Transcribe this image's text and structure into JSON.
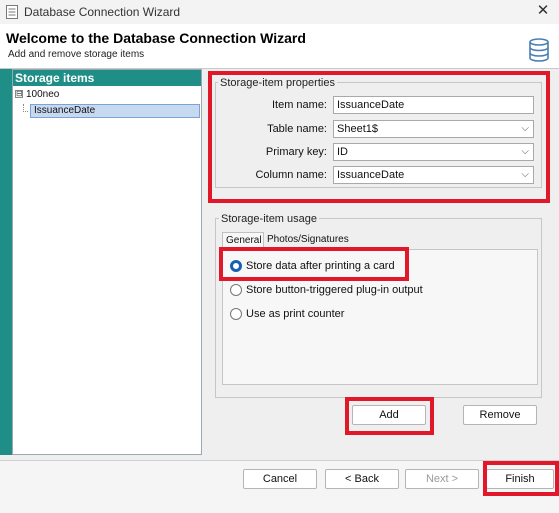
{
  "window": {
    "title": "Database Connection Wizard",
    "close_glyph": "✕"
  },
  "header": {
    "title": "Welcome to the Database Connection Wizard",
    "subtitle": "Add and remove storage items"
  },
  "tree": {
    "header": "Storage items",
    "root": {
      "label": "100neo",
      "expander": "⊟"
    },
    "child": {
      "label": "IssuanceDate",
      "selected": true
    }
  },
  "properties": {
    "legend": "Storage-item properties",
    "item_name_label": "Item name:",
    "item_name_value": "IssuanceDate",
    "table_name_label": "Table name:",
    "table_name_value": "Sheet1$",
    "primary_key_label": "Primary key:",
    "primary_key_value": "ID",
    "column_name_label": "Column name:",
    "column_name_value": "IssuanceDate",
    "chevron": "⌵"
  },
  "usage": {
    "legend": "Storage-item usage",
    "tabs": [
      {
        "label": "General",
        "active": true
      },
      {
        "label": "Photos/Signatures",
        "active": false
      }
    ],
    "options": [
      {
        "label": "Store data after printing a card",
        "checked": true
      },
      {
        "label": "Store button-triggered plug-in output",
        "checked": false
      },
      {
        "label": "Use as print counter",
        "checked": false
      }
    ],
    "add_label": "Add",
    "remove_label": "Remove"
  },
  "footer": {
    "cancel_label": "Cancel",
    "back_label": "< Back",
    "next_label": "Next >",
    "next_enabled": false,
    "finish_label": "Finish"
  },
  "colors": {
    "accent_teal": "#1f8e86",
    "selection_blue": "#c7d9f1",
    "radio_blue": "#1a5fb4",
    "annotation_red": "#e0182a"
  }
}
